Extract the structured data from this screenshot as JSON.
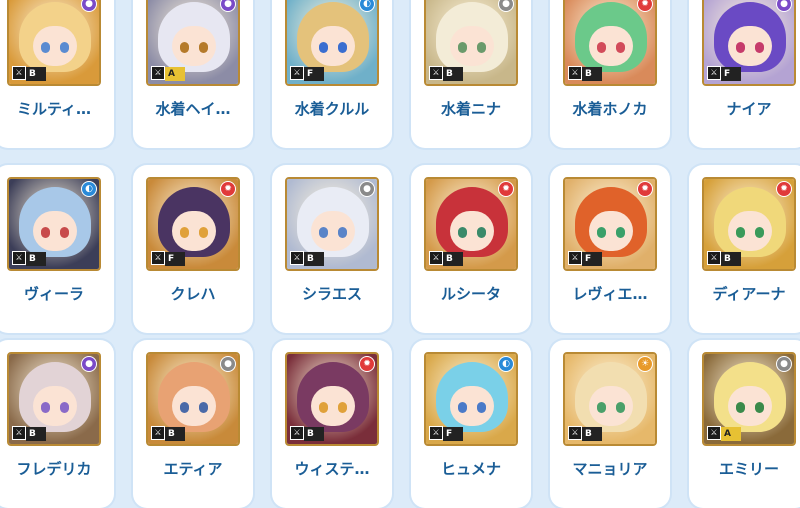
{
  "characters": [
    {
      "name": "ミルティ…",
      "rank": "B",
      "element": "purple",
      "elem_icon": "circle-icon",
      "colors": {
        "bg": "#d99a3a",
        "hair": "#f3d28a",
        "eye": "#5a8bd1"
      }
    },
    {
      "name": "水着ヘイ…",
      "rank": "A",
      "element": "purple",
      "elem_icon": "circle-icon",
      "colors": {
        "bg": "#8c8ca6",
        "hair": "#e7e7f2",
        "eye": "#b57a2a"
      }
    },
    {
      "name": "水着クルル",
      "rank": "F",
      "element": "blue",
      "elem_icon": "water-icon",
      "colors": {
        "bg": "#6fb0c9",
        "hair": "#e4c27b",
        "eye": "#3a6ed0"
      }
    },
    {
      "name": "水着ニナ",
      "rank": "B",
      "element": "grey",
      "elem_icon": "circle-icon",
      "colors": {
        "bg": "#c8b78a",
        "hair": "#f3ecd7",
        "eye": "#6a9a6b"
      }
    },
    {
      "name": "水着ホノカ",
      "rank": "B",
      "element": "red",
      "elem_icon": "fire-icon",
      "colors": {
        "bg": "#d98a5a",
        "hair": "#6bc98a",
        "eye": "#d24b5a"
      }
    },
    {
      "name": "ナイア",
      "rank": "F",
      "element": "purple",
      "elem_icon": "circle-icon",
      "colors": {
        "bg": "#b4a3d3",
        "hair": "#6a4ac4",
        "eye": "#c63b6b"
      }
    },
    {
      "name": "ヴィーラ",
      "rank": "B",
      "element": "blue",
      "elem_icon": "water-icon",
      "colors": {
        "bg": "#3c3e58",
        "hair": "#a8c8e8",
        "eye": "#c84b4b"
      }
    },
    {
      "name": "クレハ",
      "rank": "F",
      "element": "red",
      "elem_icon": "fire-icon",
      "colors": {
        "bg": "#c98a3a",
        "hair": "#4a3462",
        "eye": "#e0a13a"
      }
    },
    {
      "name": "シラエス",
      "rank": "B",
      "element": "grey",
      "elem_icon": "circle-icon",
      "colors": {
        "bg": "#b0bad1",
        "hair": "#e9ecf5",
        "eye": "#5a84c8"
      }
    },
    {
      "name": "ルシータ",
      "rank": "B",
      "element": "red",
      "elem_icon": "fire-icon",
      "colors": {
        "bg": "#d49a4a",
        "hair": "#c8323a",
        "eye": "#3a8a6a"
      }
    },
    {
      "name": "レヴィエ…",
      "rank": "F",
      "element": "red",
      "elem_icon": "fire-icon",
      "colors": {
        "bg": "#e0b06a",
        "hair": "#e0622a",
        "eye": "#3aa06a"
      }
    },
    {
      "name": "ディアーナ",
      "rank": "B",
      "element": "red",
      "elem_icon": "fire-icon",
      "colors": {
        "bg": "#d6a03a",
        "hair": "#f0d87a",
        "eye": "#3a9a5a"
      }
    },
    {
      "name": "フレデリカ",
      "rank": "B",
      "element": "purple",
      "elem_icon": "circle-icon",
      "colors": {
        "bg": "#8a6a4a",
        "hair": "#e2d3d6",
        "eye": "#8a6ac8"
      }
    },
    {
      "name": "エティア",
      "rank": "B",
      "element": "grey",
      "elem_icon": "circle-icon",
      "colors": {
        "bg": "#c88a3a",
        "hair": "#e8a273",
        "eye": "#4a6aa8"
      }
    },
    {
      "name": "ウィステ…",
      "rank": "B",
      "element": "red",
      "elem_icon": "fire-icon",
      "colors": {
        "bg": "#7a2e3a",
        "hair": "#7a3a62",
        "eye": "#e0a13a"
      }
    },
    {
      "name": "ヒュメナ",
      "rank": "F",
      "element": "blue",
      "elem_icon": "water-icon",
      "colors": {
        "bg": "#d9a84a",
        "hair": "#7ad0e8",
        "eye": "#4a7ac8"
      }
    },
    {
      "name": "マニョリア",
      "rank": "B",
      "element": "orange",
      "elem_icon": "sun-icon",
      "colors": {
        "bg": "#e6b86a",
        "hair": "#f2deb0",
        "eye": "#4aa06a"
      }
    },
    {
      "name": "エミリー",
      "rank": "A",
      "element": "grey",
      "elem_icon": "circle-icon",
      "colors": {
        "bg": "#8a6a3a",
        "hair": "#f3e08a",
        "eye": "#3a8a4a"
      }
    }
  ],
  "element_colors": {
    "purple": "#7a4ac8",
    "blue": "#2a8ad8",
    "grey": "#8a8a8a",
    "red": "#e03a3a",
    "orange": "#e89a2a"
  }
}
